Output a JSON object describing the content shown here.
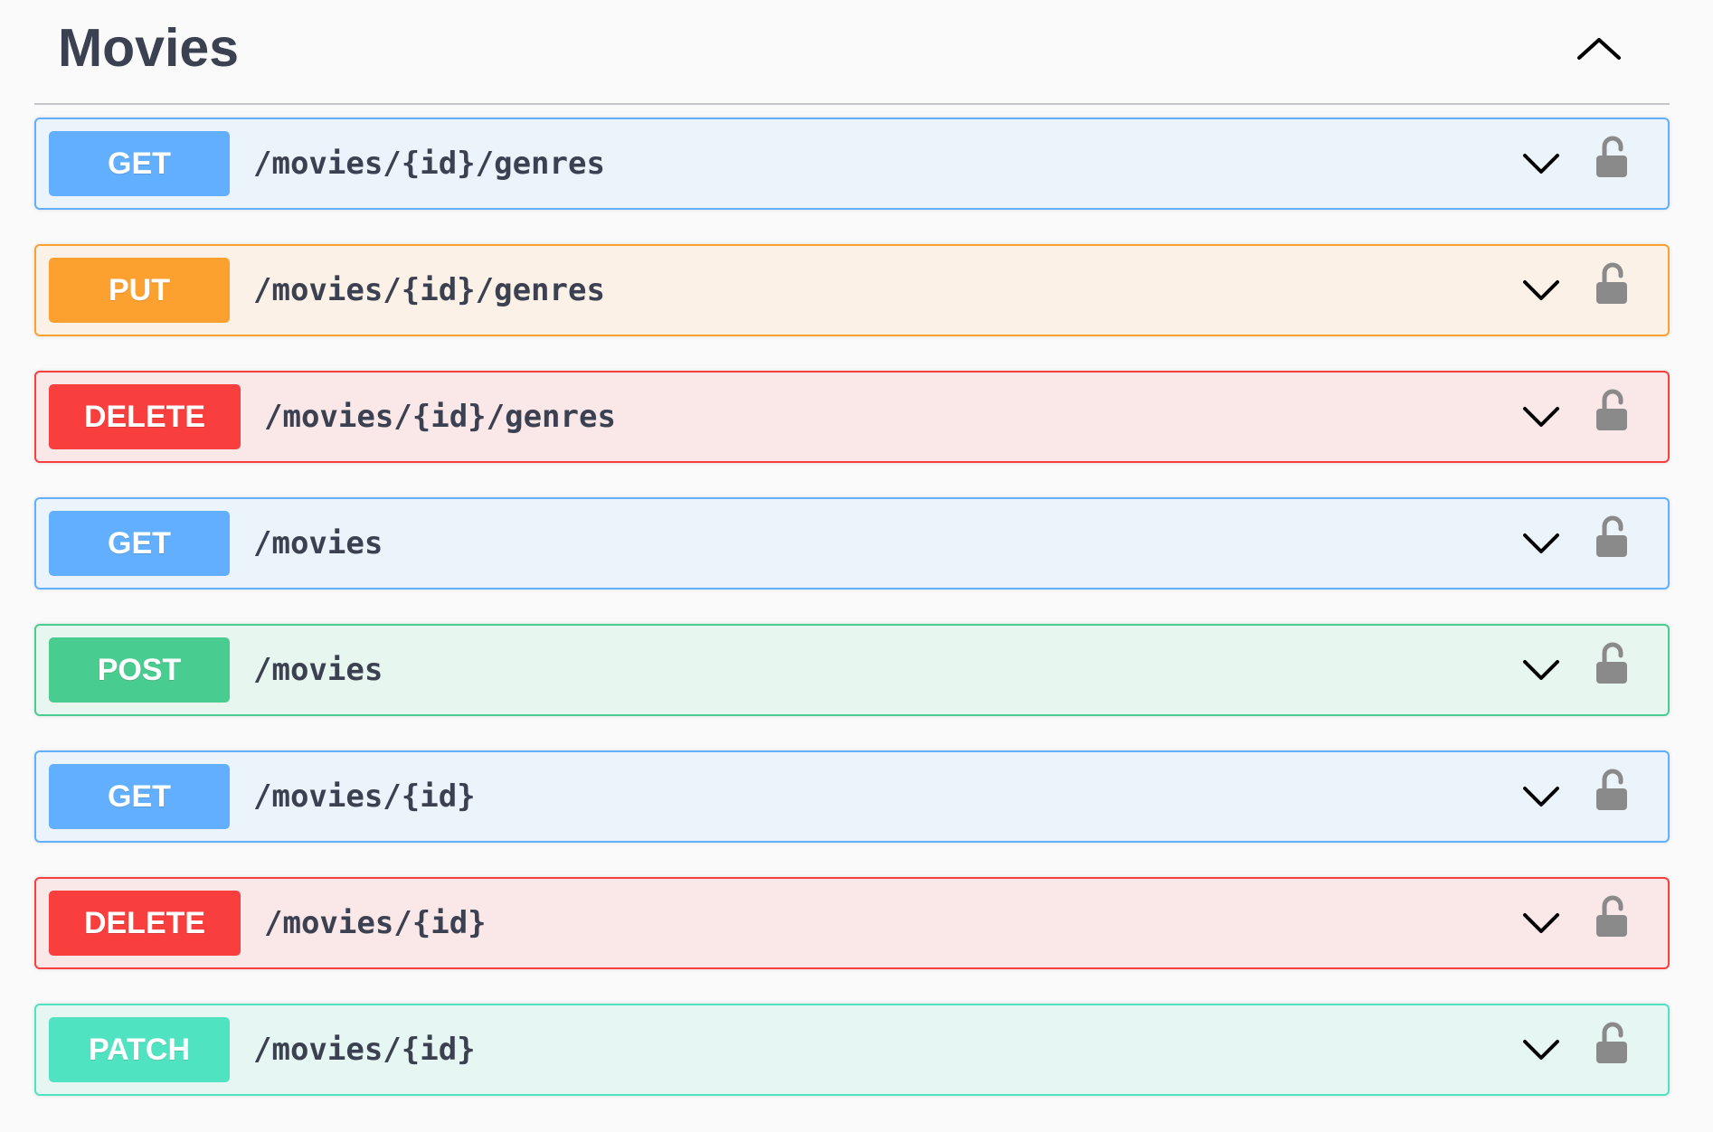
{
  "section": {
    "title": "Movies",
    "expanded": true
  },
  "operations": [
    {
      "method": "GET",
      "path": "/movies/{id}/genres"
    },
    {
      "method": "PUT",
      "path": "/movies/{id}/genres"
    },
    {
      "method": "DELETE",
      "path": "/movies/{id}/genres"
    },
    {
      "method": "GET",
      "path": "/movies"
    },
    {
      "method": "POST",
      "path": "/movies"
    },
    {
      "method": "GET",
      "path": "/movies/{id}"
    },
    {
      "method": "DELETE",
      "path": "/movies/{id}"
    },
    {
      "method": "PATCH",
      "path": "/movies/{id}"
    }
  ],
  "icons": {
    "collapse": "chevron-up-icon",
    "expand": "chevron-down-icon",
    "auth": "unlocked-padlock-icon"
  },
  "colors": {
    "GET": "#61affe",
    "PUT": "#fca130",
    "DELETE": "#f93e3e",
    "POST": "#49cc90",
    "PATCH": "#50e3c2",
    "icon_gray": "#8a8a8a"
  }
}
